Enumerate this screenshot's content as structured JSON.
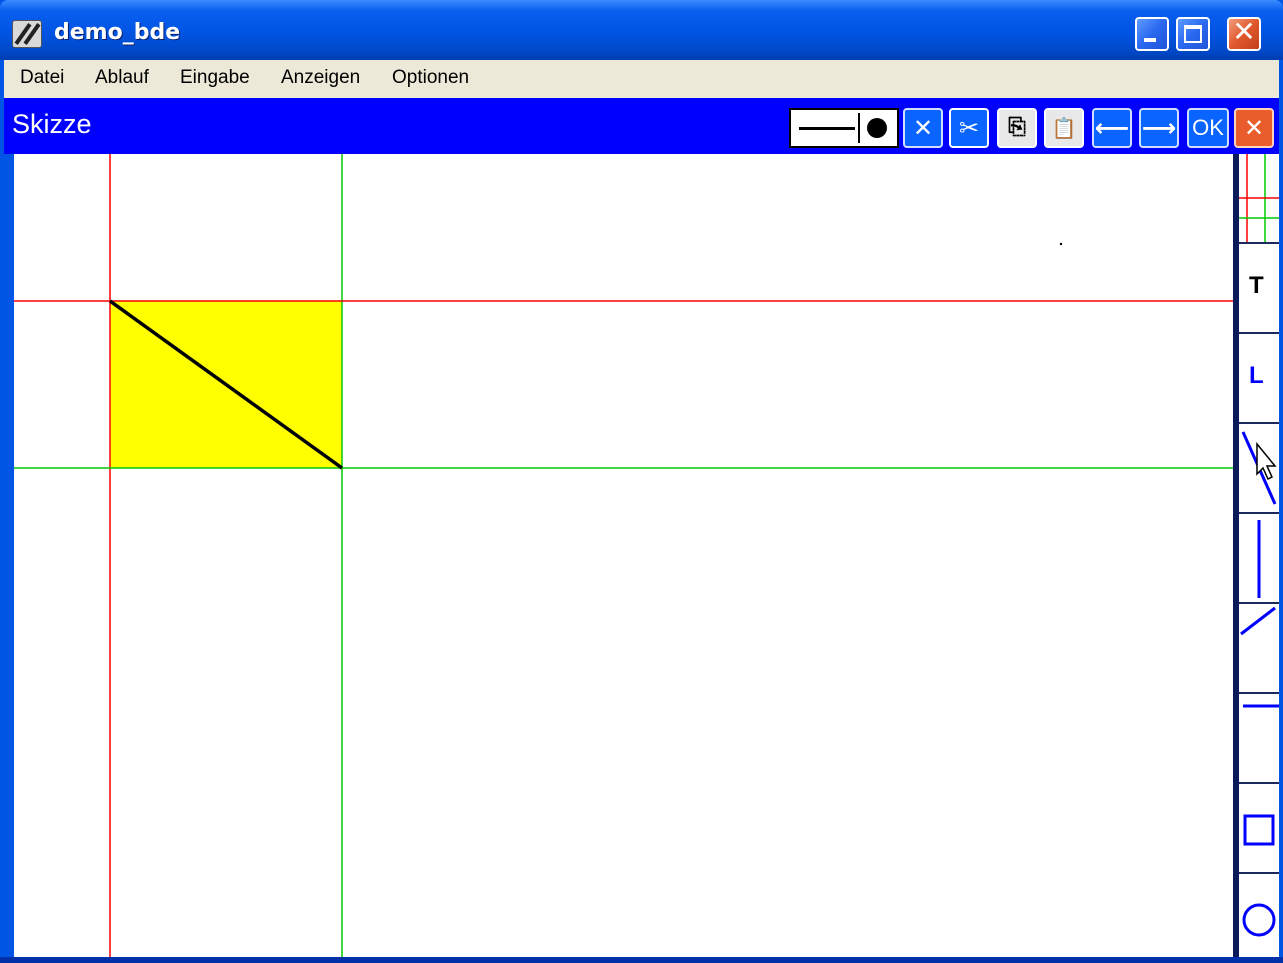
{
  "window": {
    "title": "demo_bde",
    "minimize_icon": "minimize-icon",
    "maximize_icon": "maximize-icon",
    "close_icon": "close-icon",
    "close_glyph": "✕"
  },
  "menubar": {
    "items": [
      {
        "label": "Datei"
      },
      {
        "label": "Ablauf"
      },
      {
        "label": "Eingabe"
      },
      {
        "label": "Anzeigen"
      },
      {
        "label": "Optionen"
      }
    ]
  },
  "sketch": {
    "title": "Skizze",
    "toolbar": {
      "line_width_icon": "line-width-selector",
      "delete_glyph": "✕",
      "cut_glyph": "✂",
      "copy_glyph": "⎘",
      "paste_glyph": "📋",
      "prev_glyph": "⟵",
      "next_glyph": "⟶",
      "ok_label": "OK",
      "close_glyph": "✕"
    }
  },
  "tools": {
    "text_label": "T",
    "length_label": "L"
  },
  "colors": {
    "accent": "#0000ff",
    "highlight_fill": "#ffff00",
    "guide_red": "#ff0000",
    "guide_green": "#00cc00",
    "tool_blue": "#0000ff"
  }
}
